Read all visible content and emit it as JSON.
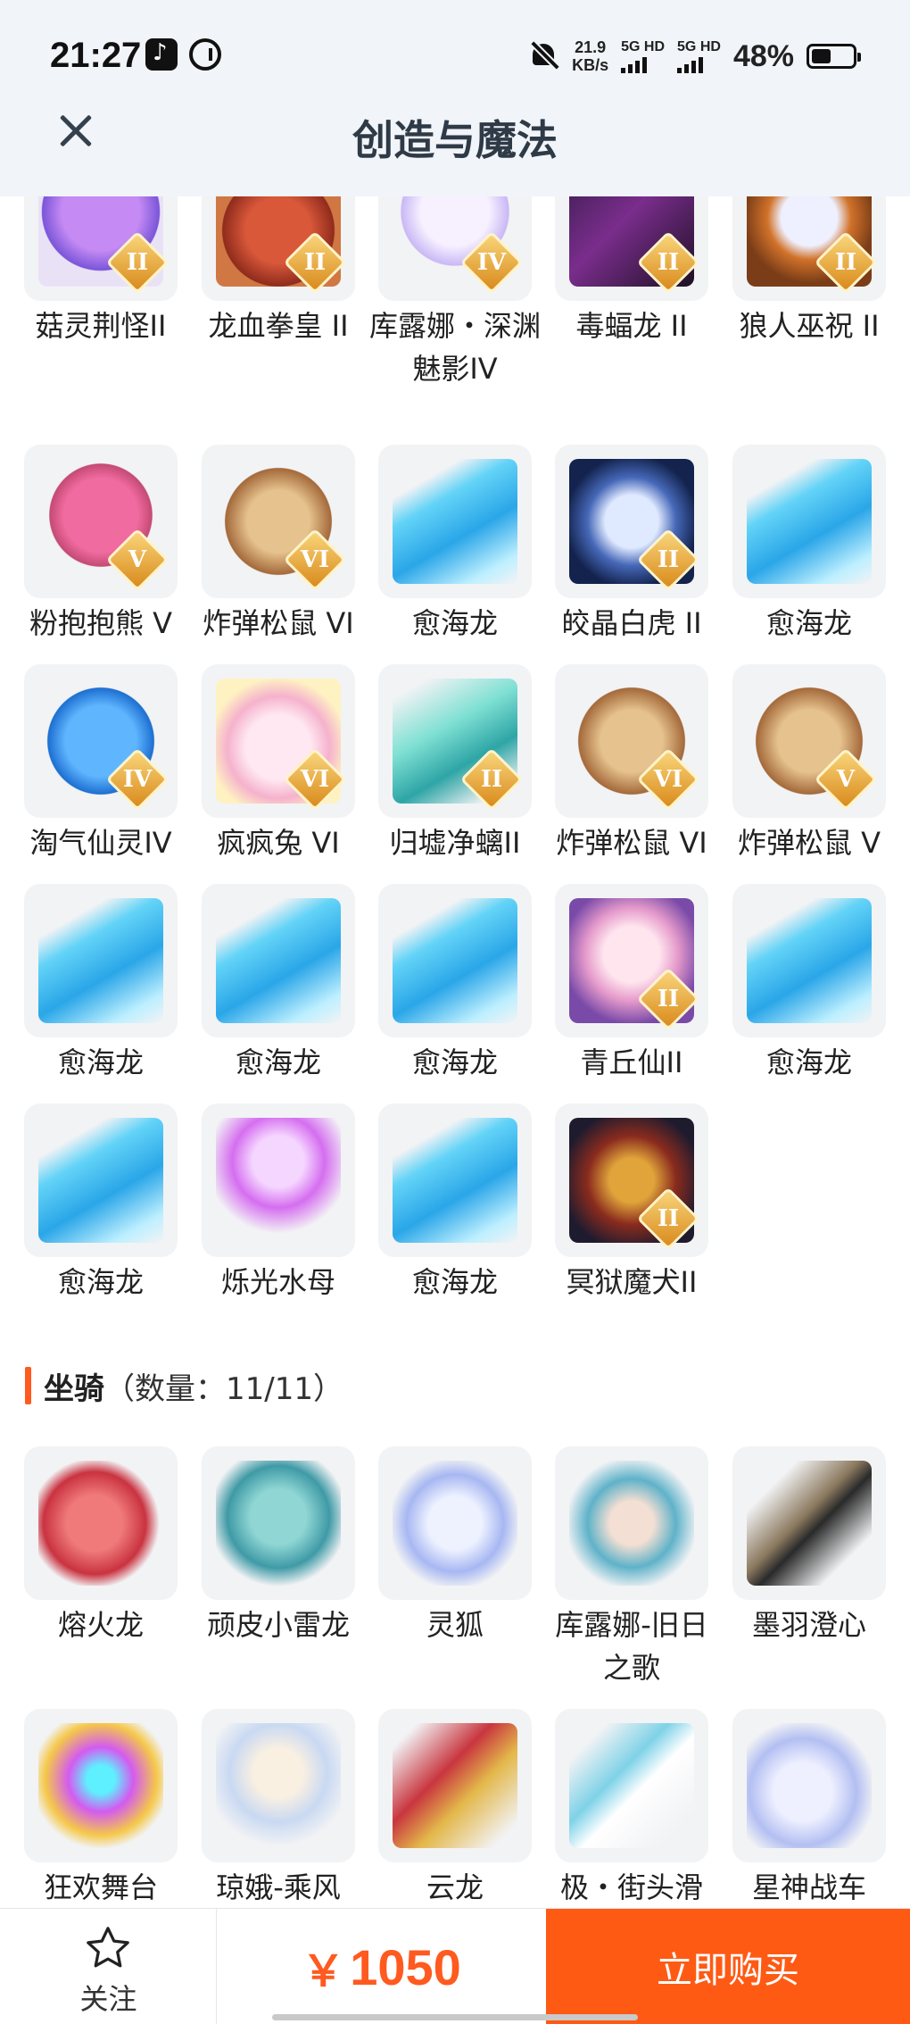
{
  "status_bar": {
    "time": "21:27",
    "net_speed_value": "21.9",
    "net_speed_unit": "KB/s",
    "sim1_label": "5G HD",
    "sim2_label": "5G HD",
    "battery_percent": "48%",
    "battery_level": 0.48,
    "icons": [
      "tiktok-icon",
      "status-ring-icon",
      "mute-icon",
      "signal-icon",
      "battery-icon"
    ]
  },
  "header": {
    "title": "创造与魔法",
    "close_icon": "close-icon"
  },
  "pets": [
    {
      "name": "菇灵荆怪II",
      "art": "a-purple",
      "badge": "II",
      "badge_color": "b-gold"
    },
    {
      "name": "龙血拳皇 II",
      "art": "a-redmon",
      "badge": "II",
      "badge_color": "b-gold"
    },
    {
      "name": "库露娜・深渊魅影IV",
      "art": "a-white",
      "badge": "IV",
      "badge_color": "b-gold"
    },
    {
      "name": "毒蝠龙 II",
      "art": "a-dark",
      "badge": "II",
      "badge_color": "b-gold"
    },
    {
      "name": "狼人巫祝 II",
      "art": "a-wolf",
      "badge": "II",
      "badge_color": "b-gold"
    },
    {
      "name": "粉抱抱熊 V",
      "art": "a-pink",
      "badge": "V",
      "badge_color": "b-gold"
    },
    {
      "name": "炸弹松鼠 VI",
      "art": "a-squirrel",
      "badge": "VI",
      "badge_color": "b-gold"
    },
    {
      "name": "愈海龙",
      "art": "a-sea",
      "badge": "",
      "badge_color": ""
    },
    {
      "name": "皎晶白虎 II",
      "art": "a-tiger",
      "badge": "II",
      "badge_color": "b-gold"
    },
    {
      "name": "愈海龙",
      "art": "a-sea",
      "badge": "",
      "badge_color": ""
    },
    {
      "name": "淘气仙灵IV",
      "art": "a-bluepup",
      "badge": "IV",
      "badge_color": "b-gold"
    },
    {
      "name": "疯疯兔 VI",
      "art": "a-rabbit",
      "badge": "VI",
      "badge_color": "b-gold"
    },
    {
      "name": "归墟净螭II",
      "art": "a-teal",
      "badge": "II",
      "badge_color": "b-gold"
    },
    {
      "name": "炸弹松鼠 VI",
      "art": "a-squirrel",
      "badge": "VI",
      "badge_color": "b-gold"
    },
    {
      "name": "炸弹松鼠 V",
      "art": "a-squirrel",
      "badge": "V",
      "badge_color": "b-gold"
    },
    {
      "name": "愈海龙",
      "art": "a-sea",
      "badge": "",
      "badge_color": ""
    },
    {
      "name": "愈海龙",
      "art": "a-sea",
      "badge": "",
      "badge_color": ""
    },
    {
      "name": "愈海龙",
      "art": "a-sea",
      "badge": "",
      "badge_color": ""
    },
    {
      "name": "青丘仙II",
      "art": "a-fox",
      "badge": "II",
      "badge_color": "b-gold"
    },
    {
      "name": "愈海龙",
      "art": "a-sea",
      "badge": "",
      "badge_color": ""
    },
    {
      "name": "愈海龙",
      "art": "a-sea",
      "badge": "",
      "badge_color": ""
    },
    {
      "name": "烁光水母",
      "art": "a-jelly",
      "badge": "",
      "badge_color": ""
    },
    {
      "name": "愈海龙",
      "art": "a-sea",
      "badge": "",
      "badge_color": ""
    },
    {
      "name": "冥狱魔犬II",
      "art": "a-hell",
      "badge": "II",
      "badge_color": "b-gold"
    }
  ],
  "mounts_section": {
    "title": "坐骑",
    "count_text": "（数量：11/11）",
    "accent_color": "#ff5a1f"
  },
  "mounts": [
    {
      "name": "熔火龙",
      "art": "a-lava"
    },
    {
      "name": "顽皮小雷龙",
      "art": "a-thunder"
    },
    {
      "name": "灵狐",
      "art": "a-spiritfox"
    },
    {
      "name": "库露娜-旧日之歌",
      "art": "a-kulu"
    },
    {
      "name": "墨羽澄心",
      "art": "a-feather"
    },
    {
      "name": "狂欢舞台",
      "art": "a-stage"
    },
    {
      "name": "琼娥-乘风",
      "art": "a-change"
    },
    {
      "name": "云龙",
      "art": "a-cloud"
    },
    {
      "name": "极・街头滑",
      "art": "a-skate"
    },
    {
      "name": "星神战车",
      "art": "a-star"
    }
  ],
  "bottom_bar": {
    "follow_label": "关注",
    "follow_icon": "star-icon",
    "currency": "￥",
    "price": "1050",
    "buy_label": "立即购买",
    "buy_color": "#ff5a14"
  }
}
